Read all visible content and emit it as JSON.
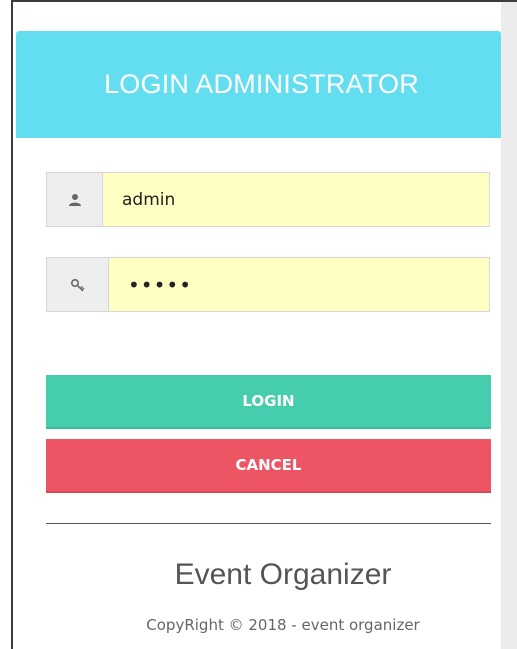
{
  "header": {
    "title": "LOGIN ADMINISTRATOR"
  },
  "form": {
    "username": {
      "value": "admin",
      "icon": "user-icon"
    },
    "password": {
      "value": "•••••",
      "icon": "key-icon"
    }
  },
  "buttons": {
    "login_label": "LOGIN",
    "cancel_label": "CANCEL"
  },
  "footer": {
    "title": "Event Organizer",
    "copyright": "CopyRight © 2018 - event organizer"
  },
  "colors": {
    "header": "#63def0",
    "input_background": "#ffffc4",
    "login": "#46cdad",
    "cancel": "#ed5565"
  }
}
